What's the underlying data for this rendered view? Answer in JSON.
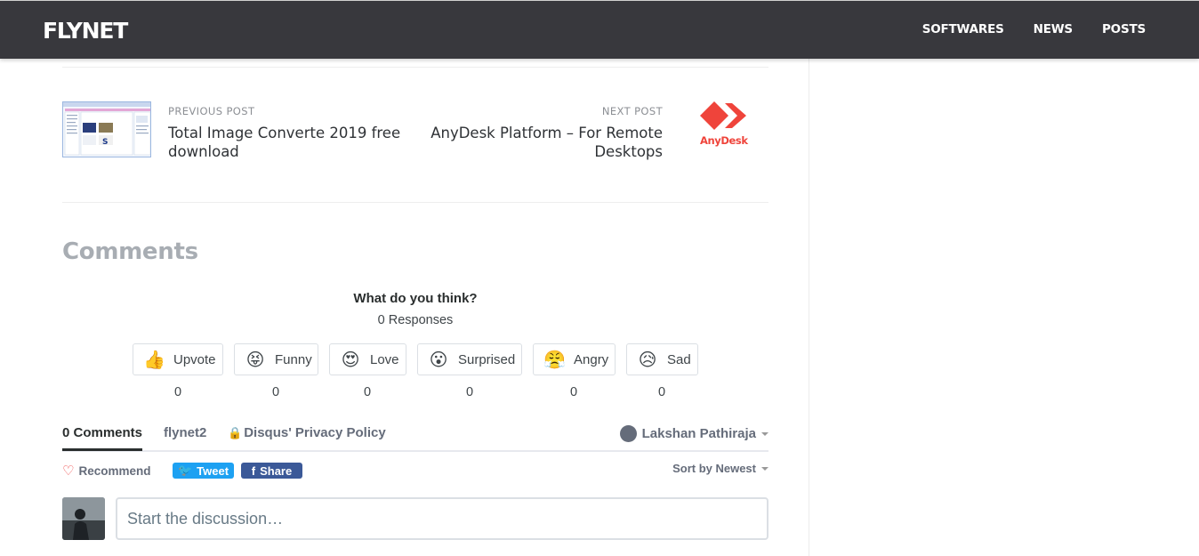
{
  "header": {
    "logo": "FLYNET",
    "nav": [
      "SOFTWARES",
      "NEWS",
      "POSTS"
    ]
  },
  "post_nav": {
    "previous": {
      "kicker": "PREVIOUS POST",
      "title": "Total Image Converte 2019 free download"
    },
    "next": {
      "kicker": "NEXT POST",
      "title": "AnyDesk Platform – For Remote Desktops",
      "logo_text": "AnyDesk"
    }
  },
  "comments": {
    "heading": "Comments",
    "prompt": "What do you think?",
    "responses": "0 Responses",
    "reactions": [
      {
        "label": "Upvote",
        "emoji": "👍",
        "count": "0"
      },
      {
        "label": "Funny",
        "emoji": "😝",
        "count": "0"
      },
      {
        "label": "Love",
        "emoji": "😍",
        "count": "0"
      },
      {
        "label": "Surprised",
        "emoji": "😮",
        "count": "0"
      },
      {
        "label": "Angry",
        "emoji": "😤",
        "count": "0"
      },
      {
        "label": "Sad",
        "emoji": "😥",
        "count": "0"
      }
    ]
  },
  "disqus": {
    "tabs": {
      "comments": "0 Comments",
      "community": "flynet2",
      "privacy": "Disqus' Privacy Policy"
    },
    "user": "Lakshan Pathiraja",
    "recommend": "Recommend",
    "tweet": "Tweet",
    "share": "Share",
    "sort": "Sort by Newest",
    "input_placeholder": "Start the discussion…"
  },
  "colors": {
    "header_bg": "#38383d",
    "anydesk_red": "#ef443b",
    "tweet_blue": "#1da1f2",
    "facebook_blue": "#3b5998"
  }
}
